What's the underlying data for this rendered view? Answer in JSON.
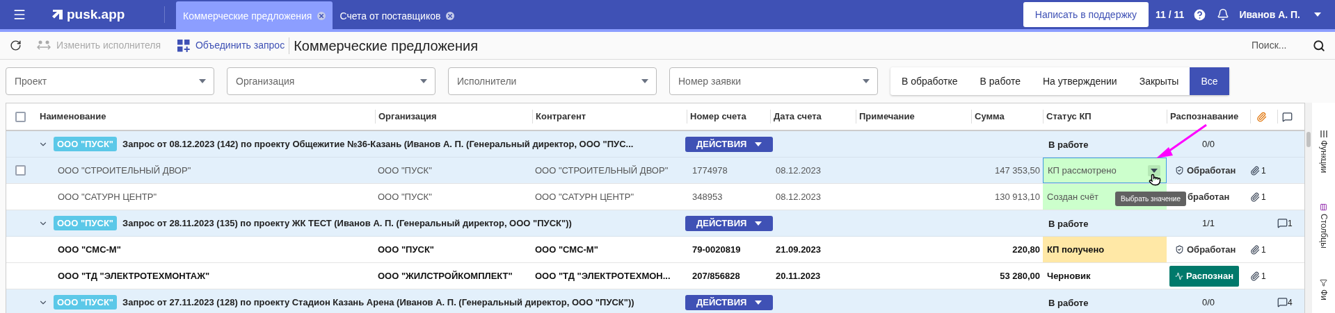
{
  "app": {
    "logo": "pusk.app"
  },
  "tabs": [
    {
      "label": "Коммерческие предложения",
      "selected": true
    },
    {
      "label": "Счета от поставщиков",
      "selected": false
    }
  ],
  "header": {
    "support_button": "Написать в поддержку",
    "counter": "11 / 11",
    "user": "Иванов А. П."
  },
  "toolbar": {
    "change_assignee": {
      "label": "Изменить исполнителя",
      "disabled": true
    },
    "merge": {
      "label": "Объединить запрос",
      "disabled": false
    },
    "title": "Коммерческие предложения",
    "search_placeholder": "Поиск..."
  },
  "filters": [
    {
      "placeholder": "Проект"
    },
    {
      "placeholder": "Организация"
    },
    {
      "placeholder": "Исполнители"
    },
    {
      "placeholder": "Номер заявки"
    }
  ],
  "status_filter": [
    {
      "label": "В обработке",
      "selected": false
    },
    {
      "label": "В работе",
      "selected": false
    },
    {
      "label": "На утверждении",
      "selected": false
    },
    {
      "label": "Закрыты",
      "selected": false
    },
    {
      "label": "Все",
      "selected": true
    }
  ],
  "table": {
    "columns": [
      "Наименование",
      "Организация",
      "Контрагент",
      "Номер счета",
      "Дата счета",
      "Примечание",
      "Сумма",
      "Статус КП",
      "Распознавание"
    ],
    "select_all_checked": false,
    "groups": [
      {
        "tag": "ООО \"ПУСК\"",
        "title": "Запрос от 08.12.2023 (142) по проекту Общежитие №36-Казань (Иванов А. П. (Генеральный директор, ООО \"ПУС...",
        "actions": "ДЕЙСТВИЯ",
        "status": "В работе",
        "recognition": "0/0",
        "expanded": true,
        "rows": [
          {
            "name": "ООО \"СТРОИТЕЛЬНЫЙ ДВОР\"",
            "organization": "ООО \"ПУСК\"",
            "counterparty": "ООО \"СТРОИТЕЛЬНЫЙ ДВОР\"",
            "invoice": "1774978",
            "date": "08.12.2023",
            "sum": "147 353,50",
            "status": {
              "text": "КП рассмотрено",
              "color": "#ccffcc",
              "focused": true
            },
            "recognition": {
              "kind": "processed",
              "text": "Обработан"
            },
            "attachments": "1",
            "selected": true,
            "checked": false,
            "unread": false
          },
          {
            "name": "ООО \"САТУРН ЦЕНТР\"",
            "organization": "ООО \"ПУСК\"",
            "counterparty": "ООО \"САТУРН ЦЕНТР\"",
            "invoice": "348953",
            "date": "08.12.2023",
            "sum": "130 913,10",
            "status": {
              "text": "Создан счёт",
              "color": "#ccffcc",
              "focused": false
            },
            "recognition": {
              "kind": "plain",
              "text": "бработан"
            },
            "attachments": "1",
            "selected": false,
            "unread": false
          }
        ]
      },
      {
        "tag": "ООО \"ПУСК\"",
        "title": "Запрос от 28.11.2023 (135) по проекту ЖК ТЕСТ (Иванов А. П. (Генеральный директор, ООО \"ПУСК\"))",
        "actions": "ДЕЙСТВИЯ",
        "status": "В работе",
        "recognition": "1/1",
        "comments": "1",
        "expanded": true,
        "rows": [
          {
            "name": "ООО \"СМС-М\"",
            "organization": "ООО \"ПУСК\"",
            "counterparty": "ООО \"СМС-М\"",
            "invoice": "79-0020819",
            "date": "21.09.2023",
            "sum": "220,80",
            "status": {
              "text": "КП получено",
              "color": "#ffe8a6",
              "focused": false
            },
            "recognition": {
              "kind": "processed",
              "text": "Обработан"
            },
            "attachments": "1",
            "selected": false,
            "unread": true
          },
          {
            "name": "ООО \"ТД \"ЭЛЕКТРОТЕХМОНТАЖ\"",
            "organization": "ООО \"ЖИЛСТРОЙКОМПЛЕКТ\"",
            "counterparty": "ООО \"ТД \"ЭЛЕКТРОТЕХМОН...",
            "invoice": "207/856828",
            "date": "20.11.2023",
            "sum": "53 280,00",
            "status": {
              "text": "Черновик"
            },
            "recognition": {
              "kind": "recognized",
              "text": "Распознан"
            },
            "attachments": "1",
            "selected": false,
            "unread": true
          }
        ]
      },
      {
        "tag": "ООО \"ПУСК\"",
        "title": "Запрос от 27.11.2023 (128) по проекту Стадион Казань Арена (Иванов А. П. (Генеральный директор, ООО \"ПУСК\"))",
        "actions": "ДЕЙСТВИЯ",
        "status": "В работе",
        "recognition": "0/0",
        "comments": "4",
        "expanded": true
      }
    ]
  },
  "tooltip": "Выбрать значение",
  "side_panel": [
    "Функции",
    "Столбцы",
    "Фи"
  ]
}
